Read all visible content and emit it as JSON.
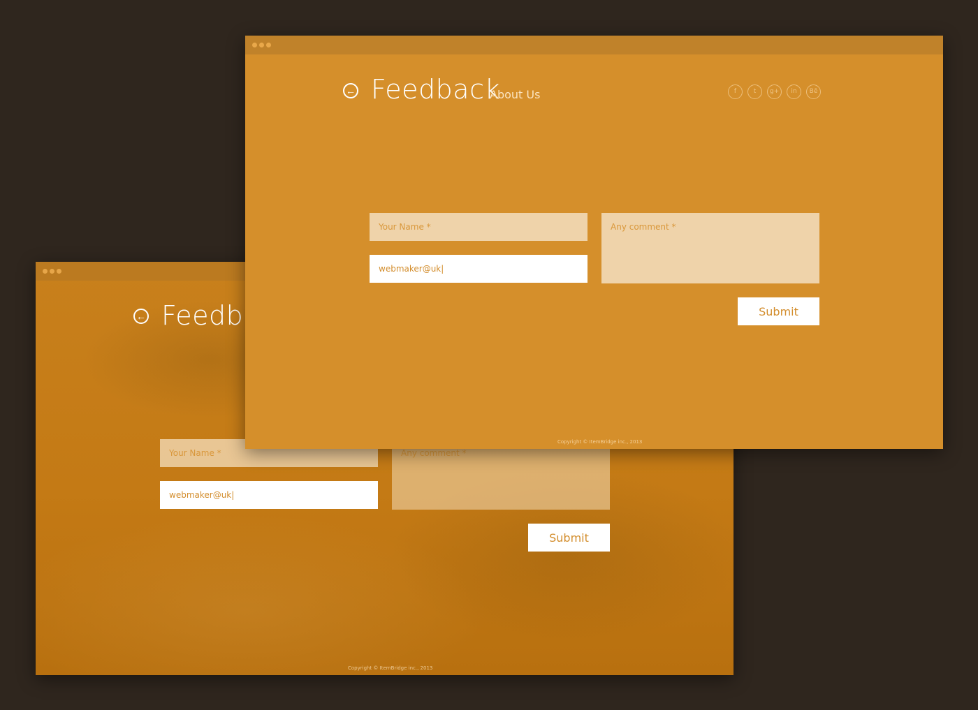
{
  "back_window": {
    "title": "Feedback",
    "form": {
      "name_placeholder": "Your Name *",
      "email_value": "webmaker@uk|",
      "comment_placeholder": "Any comment *",
      "submit_label": "Submit"
    },
    "copyright": "Copyright © ItemBridge inc., 2013"
  },
  "front_window": {
    "title": "Feedback",
    "nav_link": "About Us",
    "socials": [
      {
        "icon": "facebook-icon",
        "glyph": "f"
      },
      {
        "icon": "twitter-icon",
        "glyph": "t"
      },
      {
        "icon": "google-plus-icon",
        "glyph": "g+"
      },
      {
        "icon": "linkedin-icon",
        "glyph": "in"
      },
      {
        "icon": "behance-icon",
        "glyph": "Bē"
      }
    ],
    "form": {
      "name_placeholder": "Your Name *",
      "email_value": "webmaker@uk|",
      "comment_placeholder": "Any comment *",
      "submit_label": "Submit"
    },
    "copyright": "Copyright © ItemBridge inc., 2013"
  },
  "icons": {
    "back_glyph": "←",
    "window_dots": [
      "window-dot-1",
      "window-dot-2",
      "window-dot-3"
    ]
  },
  "colors": {
    "background": "#2f261e",
    "accent": "#d58f2b",
    "field_tint": "#efd3aa"
  }
}
